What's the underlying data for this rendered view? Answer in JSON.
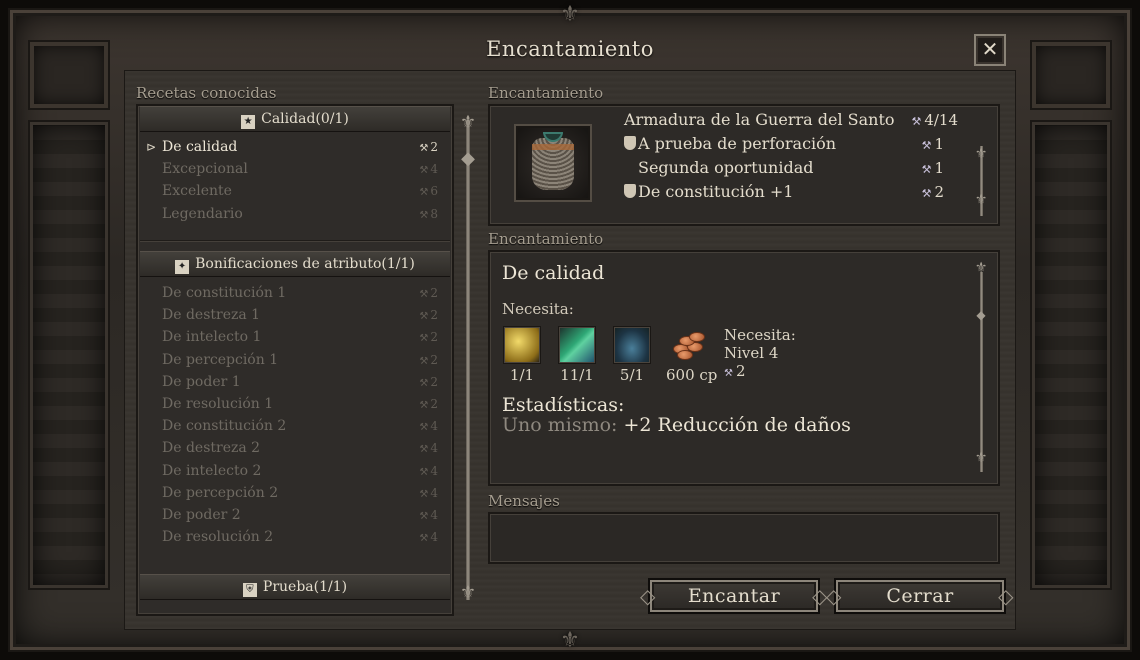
{
  "window": {
    "title": "Encantamiento",
    "close_label": "✕"
  },
  "recipes": {
    "section_label": "Recetas conocidas",
    "categories": [
      {
        "label": "Calidad(0/1)",
        "icon": "star-icon",
        "items": [
          {
            "name": "De calidad",
            "cost": "2",
            "active": true
          },
          {
            "name": "Excepcional",
            "cost": "4",
            "active": false
          },
          {
            "name": "Excelente",
            "cost": "6",
            "active": false
          },
          {
            "name": "Legendario",
            "cost": "8",
            "active": false
          }
        ]
      },
      {
        "label": "Bonificaciones de atributo(1/1)",
        "icon": "attribute-icon",
        "items": [
          {
            "name": "De constitución 1",
            "cost": "2",
            "active": false
          },
          {
            "name": "De destreza 1",
            "cost": "2",
            "active": false
          },
          {
            "name": "De intelecto 1",
            "cost": "2",
            "active": false
          },
          {
            "name": "De percepción 1",
            "cost": "2",
            "active": false
          },
          {
            "name": "De poder 1",
            "cost": "2",
            "active": false
          },
          {
            "name": "De resolución 1",
            "cost": "2",
            "active": false
          },
          {
            "name": "De constitución 2",
            "cost": "4",
            "active": false
          },
          {
            "name": "De destreza 2",
            "cost": "4",
            "active": false
          },
          {
            "name": "De intelecto 2",
            "cost": "4",
            "active": false
          },
          {
            "name": "De percepción 2",
            "cost": "4",
            "active": false
          },
          {
            "name": "De poder 2",
            "cost": "4",
            "active": false
          },
          {
            "name": "De resolución 2",
            "cost": "4",
            "active": false
          }
        ]
      },
      {
        "label": "Prueba(1/1)",
        "icon": "shield-icon",
        "items": []
      }
    ]
  },
  "item": {
    "section_label": "Encantamiento",
    "name": "Armadura de la Guerra del Santo",
    "capacity": "4/14",
    "enchantments": [
      {
        "name": "A prueba de perforación",
        "cost": "1",
        "has_icon": true
      },
      {
        "name": "Segunda oportunidad",
        "cost": "1",
        "has_icon": false
      },
      {
        "name": "De constitución +1",
        "cost": "2",
        "has_icon": true
      }
    ]
  },
  "detail": {
    "section_label": "Encantamiento",
    "title": "De calidad",
    "needs_label": "Necesita:",
    "ingredients": [
      {
        "name": "gold-ore-icon",
        "count": "1/1",
        "color": "#c9a93c"
      },
      {
        "name": "green-crystal-icon",
        "count": "11/1",
        "color": "#3f8d5a"
      },
      {
        "name": "blue-shell-icon",
        "count": "5/1",
        "color": "#3a5f7a"
      },
      {
        "name": "copper-coins-icon",
        "count": "600 cp",
        "color": "#c06a3a"
      }
    ],
    "requirements": {
      "label": "Necesita:",
      "level": "Nivel 4",
      "cost": "2"
    },
    "stats_label": "Estadísticas:",
    "stats_who": "Uno mismo:",
    "stats_value": "+2 Reducción de daños"
  },
  "messages": {
    "section_label": "Mensajes"
  },
  "buttons": {
    "enchant": "Encantar",
    "close": "Cerrar"
  },
  "colors": {
    "accent_text": "#e3dccc",
    "dim_text": "#6f6a62",
    "cost_icon": "#c7bfd8"
  }
}
